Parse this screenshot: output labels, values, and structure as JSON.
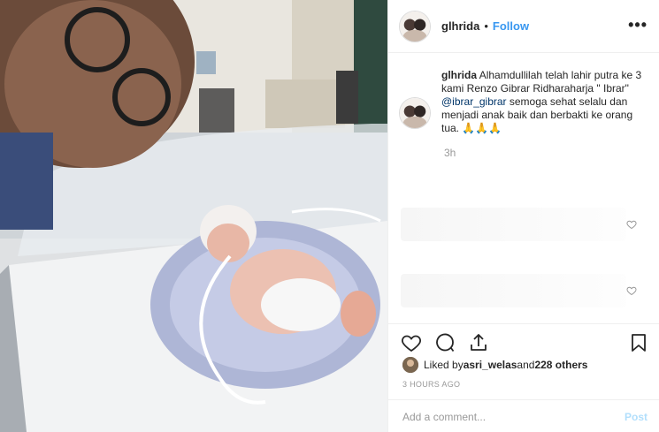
{
  "post": {
    "username": "glhrida",
    "separator": "•",
    "follow_label": "Follow",
    "more_label": "•••"
  },
  "caption": {
    "username": "glhrida",
    "text_before_mention": " Alhamdullilah telah lahir putra ke 3 kami Renzo Gibrar Ridharaharja \" Ibrar\" ",
    "mention": "@ibrar_gibrar",
    "text_after_mention": " semoga sehat selalu dan menjadi anak baik dan berbakti ke orang tua. 🙏🙏🙏",
    "time": "3h"
  },
  "actions": {
    "like_icon": "heart-icon",
    "comment_icon": "comment-icon",
    "share_icon": "share-icon",
    "save_icon": "bookmark-icon"
  },
  "likes": {
    "prefix": "Liked by ",
    "user": "asri_welas",
    "middle": " and ",
    "others": "228 others"
  },
  "timestamp": "3 HOURS AGO",
  "comment_box": {
    "placeholder": "Add a comment...",
    "post_label": "Post"
  },
  "colors": {
    "accent": "#3897f0",
    "post_disabled": "#b2dffc",
    "mention": "#003569"
  }
}
